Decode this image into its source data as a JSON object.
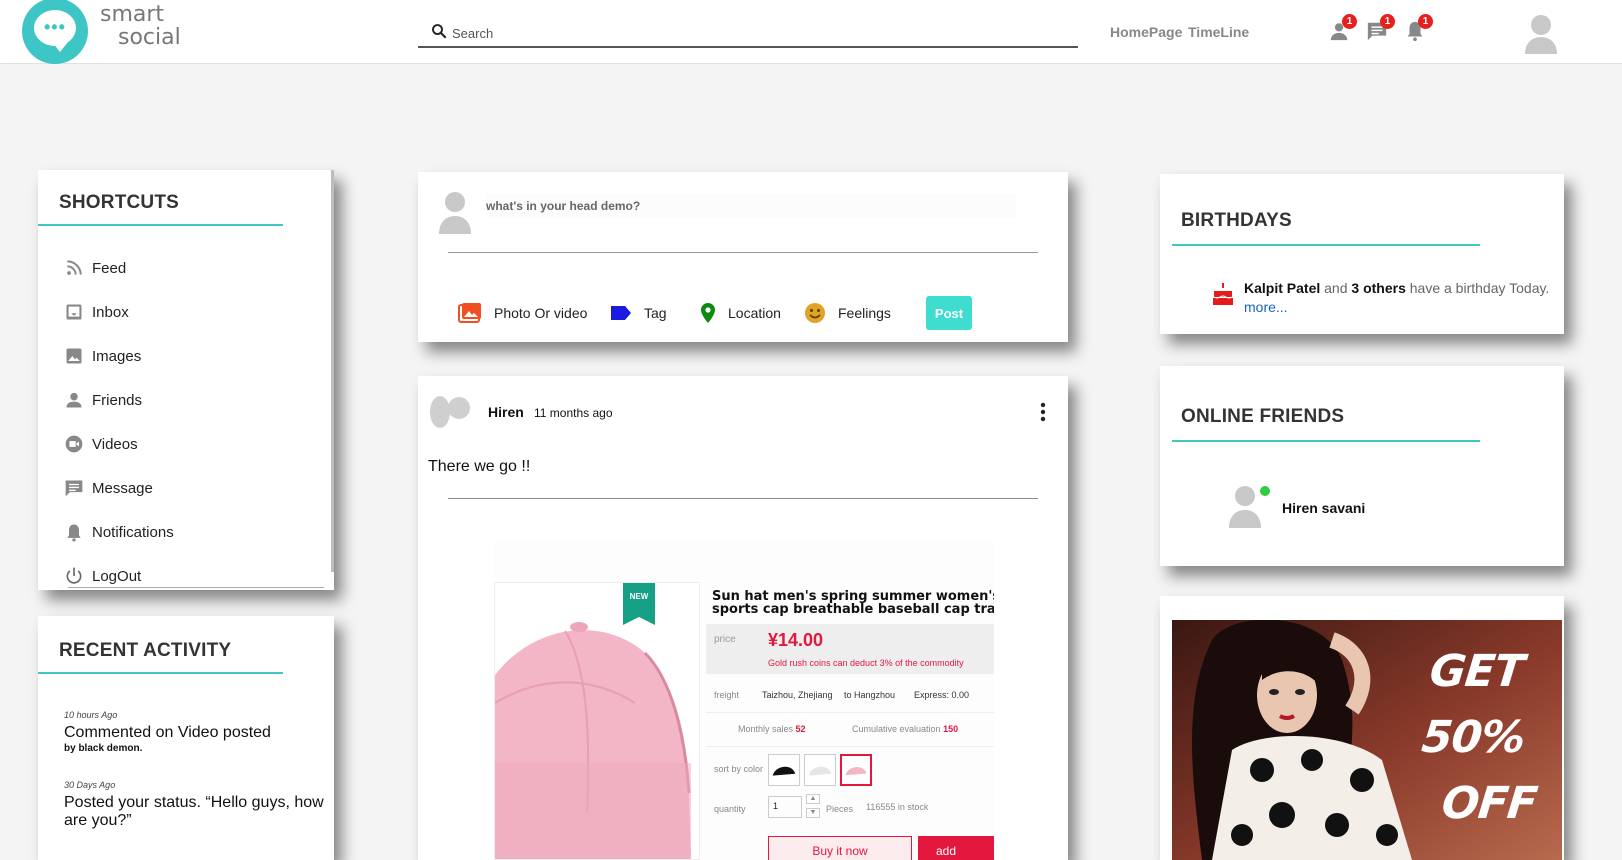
{
  "brand": {
    "line1": "smart",
    "line2": "social",
    "color": "#3ec6c6"
  },
  "search": {
    "placeholder": "Search"
  },
  "nav": {
    "home": "HomePage",
    "timeline": "TimeLine"
  },
  "notifications": [
    {
      "icon": "person-icon",
      "count": "1"
    },
    {
      "icon": "message-icon",
      "count": "1"
    },
    {
      "icon": "bell-icon",
      "count": "1"
    }
  ],
  "shortcuts": {
    "title": "SHORTCUTS",
    "items": [
      {
        "icon": "rss-feed-icon",
        "label": "Feed"
      },
      {
        "icon": "inbox-icon",
        "label": "Inbox"
      },
      {
        "icon": "image-icon",
        "label": "Images"
      },
      {
        "icon": "person-icon",
        "label": "Friends"
      },
      {
        "icon": "video-icon",
        "label": "Videos"
      },
      {
        "icon": "message-icon",
        "label": "Message"
      },
      {
        "icon": "bell-icon",
        "label": "Notifications"
      },
      {
        "icon": "power-icon",
        "label": "LogOut"
      }
    ]
  },
  "recent_activity": {
    "title": "RECENT ACTIVITY",
    "items": [
      {
        "time": "10 hours Ago",
        "text": "Commented on Video posted",
        "by": "by black demon."
      },
      {
        "time": "30 Days Ago",
        "text": "Posted your status. “Hello guys, how are you?”"
      }
    ]
  },
  "composer": {
    "placeholder": "what's in your head demo?",
    "actions": [
      {
        "icon": "photo-icon",
        "label": "Photo Or video"
      },
      {
        "icon": "tag-icon",
        "label": "Tag"
      },
      {
        "icon": "location-icon",
        "label": "Location"
      },
      {
        "icon": "smiley-icon",
        "label": "Feelings"
      }
    ],
    "post_label": "Post"
  },
  "post": {
    "author": "Hiren",
    "time": "11 months ago",
    "text": "There we go !!",
    "product": {
      "badge": "NEW",
      "title_line1": "Sun hat men's spring summer women's p",
      "title_line2": "sports cap breathable baseball cap travel",
      "price_label": "price",
      "price": "¥14.00",
      "price_note": "Gold rush coins can deduct 3% of the commodity",
      "freight_label": "freight",
      "freight_from": "Taizhou, Zhejiang",
      "freight_to": "to Hangzhou",
      "express": "Express: 0.00",
      "monthly_label": "Monthly sales",
      "monthly_value": "52",
      "cumulative_label": "Cumulative evaluation",
      "cumulative_value": "150",
      "color_label": "sort by color",
      "quantity_label": "quantity",
      "quantity_value": "1",
      "pieces": "Pieces",
      "stock": "116555 in stock",
      "buy_label": "Buy it now",
      "add_label": "add"
    }
  },
  "birthdays": {
    "title": "BIRTHDAYS",
    "name": "Kalpit Patel",
    "and": "and",
    "others": "3 others",
    "suffix": "have a birthday Today.",
    "more": "more..."
  },
  "online_friends": {
    "title": "ONLINE FRIENDS",
    "friends": [
      {
        "name": "Hiren savani",
        "status_color": "#2ecc40"
      }
    ]
  },
  "ad": {
    "line1": "GET",
    "line2": "50%",
    "line3": "OFF"
  },
  "colors": {
    "accent": "#40c8c0",
    "post_button": "#3fdcd0",
    "badge": "#e52020",
    "price": "#e4173e"
  }
}
